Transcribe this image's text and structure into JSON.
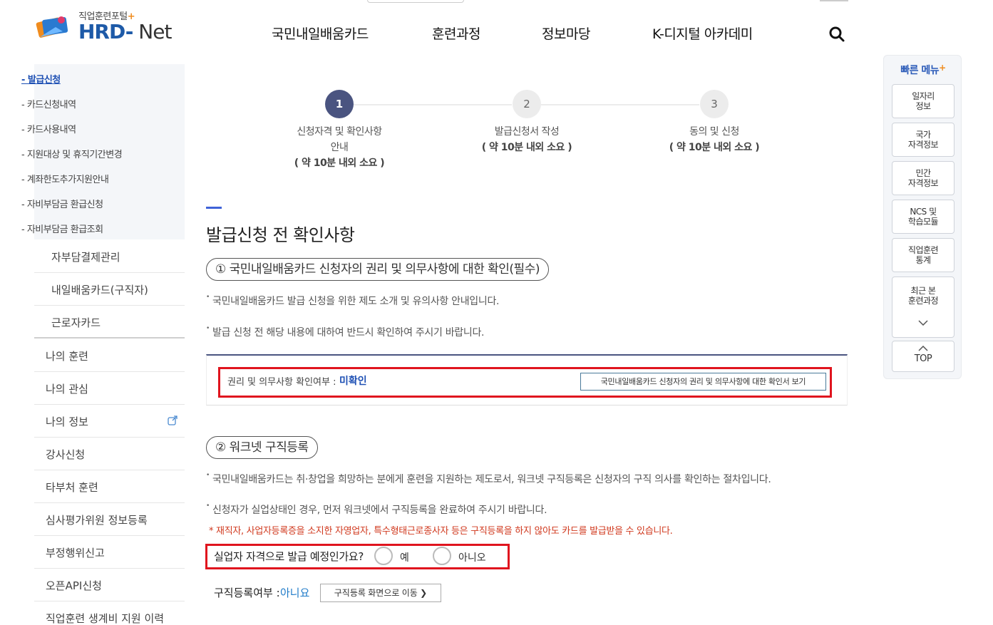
{
  "header": {
    "logo_sub": "직업훈련포털",
    "logo_plus": "+",
    "logo_main_a": "HRD-",
    "logo_main_b": " Net",
    "gnb": [
      "국민내일배움카드",
      "훈련과정",
      "정보마당",
      "K-디지털 아카데미"
    ]
  },
  "sidebar": {
    "sub_items": [
      "- 발급신청",
      "- 카드신청내역",
      "- 카드사용내역",
      "- 지원대상 및 휴직기간변경",
      "- 계좌한도추가지원안내",
      "- 자비부담금 환급신청",
      "- 자비부담금 환급조회"
    ],
    "groups": [
      "자부담결제관리",
      "내일배움카드(구직자)",
      "근로자카드"
    ],
    "main": [
      "나의 훈련",
      "나의 관심",
      "나의 정보",
      "강사신청",
      "타부처 훈련",
      "심사평가위원 정보등록",
      "부정행위신고",
      "오픈API신청",
      "직업훈련 생계비 지원 이력"
    ]
  },
  "steps": [
    {
      "num": "1",
      "line1": "신청자격 및 확인사항",
      "line2": "안내",
      "time": "( 약 10분 내외 소요 )"
    },
    {
      "num": "2",
      "line1": "발급신청서 작성",
      "time": "( 약 10분 내외 소요 )"
    },
    {
      "num": "3",
      "line1": "동의 및 신청",
      "time": "( 약 10분 내외 소요 )"
    }
  ],
  "main": {
    "title": "발급신청 전 확인사항",
    "section1": {
      "pill": "① 국민내일배움카드 신청자의 권리 및 의무사항에 대한 확인(필수)",
      "bullets": [
        "국민내일배움카드 발급 신청을 위한 제도 소개 및 유의사항 안내입니다.",
        "발급 신청 전 해당 내용에 대하여 반드시 확인하여 주시기 바랍니다."
      ],
      "confirm_label": "권리 및 의무사항 확인여부 :",
      "confirm_status": "미확인",
      "confirm_button": "국민내일배움카드 신청자의 권리 및 의무사항에 대한 확인서 보기"
    },
    "section2": {
      "pill": "② 워크넷 구직등록",
      "bullets": [
        "국민내일배움카드는 취·창업을 희망하는 분에게 훈련을 지원하는 제도로서, 워크넷 구직등록은 신청자의 구직 의사를 확인하는 절차입니다.",
        "신청자가 실업상태인 경우, 먼저 워크넷에서 구직등록을 완료하여 주시기 바랍니다."
      ],
      "note": "* 재직자, 사업자등록증을 소지한 자영업자, 특수형태근로종사자 등은 구직등록을 하지 않아도 카드를 발급받을 수 있습니다.",
      "question": "실업자 자격으로 발급 예정인가요?",
      "option_yes": "예",
      "option_no": "아니오",
      "reg_label": "구직등록여부 :",
      "reg_value": "아니요",
      "reg_button": "구직등록 화면으로 이동 ❯"
    }
  },
  "quick_menu": {
    "title": "빠른 메뉴",
    "plus": "+",
    "items": [
      [
        "일자리",
        "정보"
      ],
      [
        "국가",
        "자격정보"
      ],
      [
        "민간",
        "자격정보"
      ],
      [
        "NCS 및",
        "학습모듈"
      ],
      [
        "직업훈련",
        "통계"
      ],
      [
        "최근 본",
        "훈련과정"
      ]
    ],
    "top": "TOP"
  }
}
